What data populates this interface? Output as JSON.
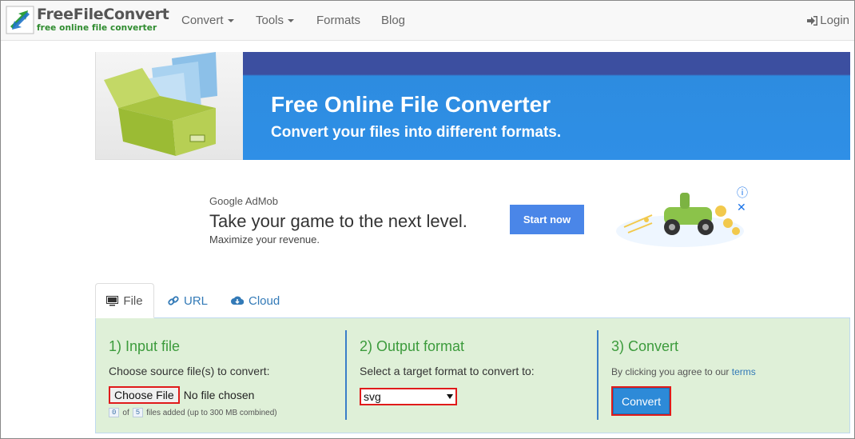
{
  "brand": {
    "title": "FreeFileConvert",
    "subtitle": "free online file converter"
  },
  "nav": {
    "items": [
      {
        "label": "Convert",
        "dropdown": true
      },
      {
        "label": "Tools",
        "dropdown": true
      },
      {
        "label": "Formats",
        "dropdown": false
      },
      {
        "label": "Blog",
        "dropdown": false
      }
    ],
    "login": "Login"
  },
  "hero": {
    "title": "Free Online File Converter",
    "subtitle": "Convert your files into different formats."
  },
  "ad": {
    "brand": "Google AdMob",
    "headline": "Take your game to the next level.",
    "sub": "Maximize your revenue.",
    "button": "Start now"
  },
  "tabs": [
    {
      "label": "File",
      "icon": "monitor-icon",
      "active": true
    },
    {
      "label": "URL",
      "icon": "link-icon",
      "active": false
    },
    {
      "label": "Cloud",
      "icon": "cloud-download-icon",
      "active": false
    }
  ],
  "steps": {
    "input": {
      "title": "1) Input file",
      "desc": "Choose source file(s) to convert:",
      "choose_label": "Choose File",
      "no_file": "No file chosen",
      "added": "0",
      "of": "of",
      "max": "5",
      "note": "files added (up to 300 MB combined)"
    },
    "output": {
      "title": "2) Output format",
      "desc": "Select a target format to convert to:",
      "selected": "svg"
    },
    "convert": {
      "title": "3) Convert",
      "agree_prefix": "By clicking you agree to our",
      "terms": "terms",
      "button": "Convert"
    }
  },
  "colors": {
    "accent": "#337ab7",
    "panel": "#dff0d8",
    "heading_green": "#3c9b3c",
    "highlight": "#e01b1b",
    "hero_blue": "#2f8fe6"
  }
}
